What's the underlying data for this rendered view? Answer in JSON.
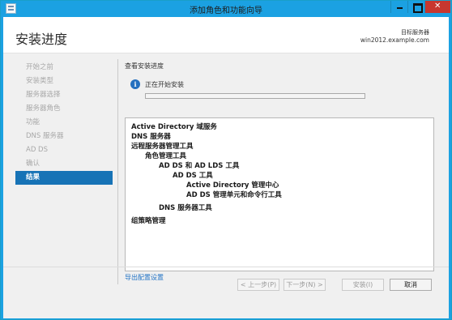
{
  "window": {
    "title": "添加角色和功能向导",
    "icon": "wizard-app-icon",
    "controls": [
      "minimize-icon",
      "maximize-icon",
      "close-icon"
    ]
  },
  "header": {
    "page_title": "安装进度",
    "server_label": "目标服务器",
    "server_name": "win2012.example.com"
  },
  "sidebar": {
    "items": [
      {
        "label": "开始之前",
        "active": false
      },
      {
        "label": "安装类型",
        "active": false
      },
      {
        "label": "服务器选择",
        "active": false
      },
      {
        "label": "服务器角色",
        "active": false
      },
      {
        "label": "功能",
        "active": false
      },
      {
        "label": "DNS 服务器",
        "active": false
      },
      {
        "label": "AD DS",
        "active": false
      },
      {
        "label": "确认",
        "active": false
      },
      {
        "label": "结果",
        "active": true
      }
    ]
  },
  "main": {
    "section_title": "查看安装进度",
    "status_text": "正在开始安装",
    "progress": 0,
    "results": [
      {
        "text": "Active Directory 域服务",
        "indent": 0
      },
      {
        "text": "DNS 服务器",
        "indent": 0
      },
      {
        "text": "远程服务器管理工具",
        "indent": 0
      },
      {
        "text": "角色管理工具",
        "indent": 1
      },
      {
        "text": "AD DS 和 AD LDS 工具",
        "indent": 2
      },
      {
        "text": "AD DS 工具",
        "indent": 3
      },
      {
        "text": "Active Directory 管理中心",
        "indent": 4
      },
      {
        "text": "AD DS 管理单元和命令行工具",
        "indent": 4
      },
      {
        "text": "DNS 服务器工具",
        "indent": 2
      },
      {
        "text": "组策略管理",
        "indent": 0
      }
    ],
    "export_link": "导出配置设置"
  },
  "footer": {
    "prev_label": "< 上一步(P)",
    "next_label": "下一步(N) >",
    "install_label": "安装(I)",
    "cancel_label": "取消"
  },
  "colors": {
    "titlebar": "#1ba1e2",
    "close_button": "#c7372f",
    "nav_active": "#1773b6",
    "link": "#2373c5",
    "info_icon": "#2470bf"
  }
}
